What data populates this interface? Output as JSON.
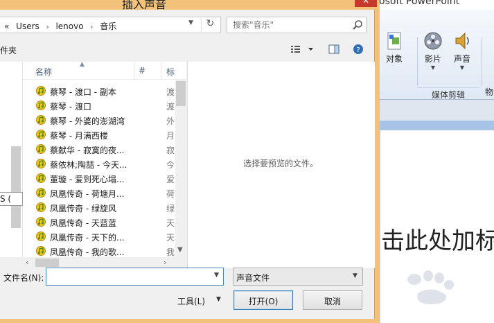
{
  "dialog": {
    "title": "插入声音",
    "close_glyph": "✕"
  },
  "address": {
    "prefix": "«",
    "crumbs": [
      "Users",
      "lenovo",
      "音乐"
    ],
    "separator": "›",
    "refresh_glyph": "↻"
  },
  "search": {
    "placeholder": "搜索\"音乐\""
  },
  "toolbar": {
    "new_folder_label": "件夹"
  },
  "list": {
    "columns": {
      "name": "名称",
      "num": "#",
      "title": "标"
    },
    "rows": [
      {
        "name": "蔡琴 - 渡口 - 副本",
        "title": "渡"
      },
      {
        "name": "蔡琴 - 渡口",
        "title": "渡"
      },
      {
        "name": "蔡琴 - 外婆的澎湖湾",
        "title": "外"
      },
      {
        "name": "蔡琴 - 月满西楼",
        "title": "月"
      },
      {
        "name": "蔡献华 - 寂寞的夜...",
        "title": "寂"
      },
      {
        "name": "蔡依林;陶喆 - 今天...",
        "title": "今"
      },
      {
        "name": "董璇 - 爱到死心塌...",
        "title": "爱"
      },
      {
        "name": "凤凰传奇 - 荷塘月...",
        "title": "荷"
      },
      {
        "name": "凤凰传奇 - 绿旋风",
        "title": "绿"
      },
      {
        "name": "凤凰传奇 - 天蓝蓝",
        "title": "天"
      },
      {
        "name": "凤凰传奇 - 天下的...",
        "title": "天"
      },
      {
        "name": "凤凰传奇 - 我的歌...",
        "title": "我"
      }
    ]
  },
  "nav": {
    "partial_label": "S ("
  },
  "preview": {
    "empty_text": "选择要预览的文件。"
  },
  "footer": {
    "filename_label": "文件名(N):",
    "filename_value": "",
    "type_value": "声音文件",
    "tools_label": "工具(L)",
    "open_label": "打开(O)",
    "cancel_label": "取消"
  },
  "ppt": {
    "title_partial": "osoft PowerPoint",
    "ribbon_items": [
      {
        "label": "对象",
        "icon": "object-icon"
      },
      {
        "label": "影片",
        "icon": "film-reel-icon"
      },
      {
        "label": "声音",
        "icon": "speaker-icon"
      }
    ],
    "group_label": "媒体剪辑",
    "cut_label": "物",
    "placeholder_text": "击此处加标"
  },
  "colors": {
    "dialog_frame": "#f3c27a",
    "close": "#c9392b",
    "accent_border": "#3f84c5",
    "ribbon": "#dfe9f5"
  }
}
